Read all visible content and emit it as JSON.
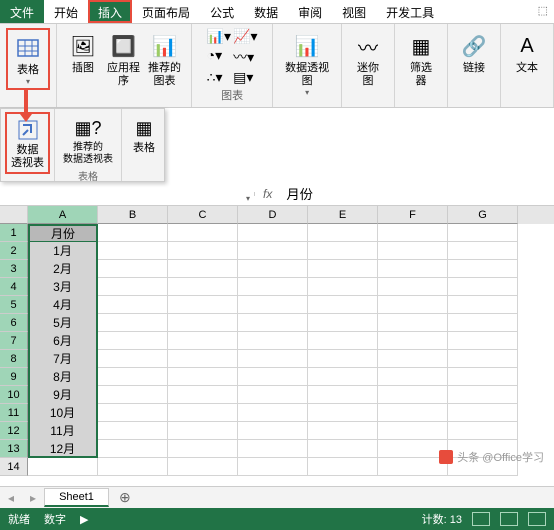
{
  "tabs": {
    "file": "文件",
    "home": "开始",
    "insert": "插入",
    "layout": "页面布局",
    "formula": "公式",
    "data": "数据",
    "review": "审阅",
    "view": "视图",
    "dev": "开发工具"
  },
  "ribbon": {
    "tables": {
      "label": "表格",
      "btn": "表格"
    },
    "illustrations": {
      "pic": "插图",
      "app": "应用程\n序",
      "rec_chart": "推荐的\n图表"
    },
    "charts": {
      "label": "图表",
      "pivot_chart": "数据透视图"
    },
    "sparklines": {
      "label": "迷你图"
    },
    "filter": {
      "label": "筛选器"
    },
    "link": {
      "label": "链接"
    },
    "text": {
      "label": "文本"
    }
  },
  "sub_ribbon": {
    "pivot": "数据\n透视表",
    "rec_pivot": "推荐的\n数据透视表",
    "table": "表格",
    "group": "表格"
  },
  "formula_bar": {
    "value": "月份"
  },
  "columns": [
    "A",
    "B",
    "C",
    "D",
    "E",
    "F",
    "G"
  ],
  "rows": [
    {
      "n": 1,
      "v": "月份"
    },
    {
      "n": 2,
      "v": "1月"
    },
    {
      "n": 3,
      "v": "2月"
    },
    {
      "n": 4,
      "v": "3月"
    },
    {
      "n": 5,
      "v": "4月"
    },
    {
      "n": 6,
      "v": "5月"
    },
    {
      "n": 7,
      "v": "6月"
    },
    {
      "n": 8,
      "v": "7月"
    },
    {
      "n": 9,
      "v": "8月"
    },
    {
      "n": 10,
      "v": "9月"
    },
    {
      "n": 11,
      "v": "10月"
    },
    {
      "n": 12,
      "v": "11月"
    },
    {
      "n": 13,
      "v": "12月"
    },
    {
      "n": 14,
      "v": ""
    }
  ],
  "sheet": {
    "name": "Sheet1"
  },
  "status": {
    "ready": "就绪",
    "mode": "数字",
    "count": "计数: 13"
  },
  "watermark": "头条 @Office学习"
}
